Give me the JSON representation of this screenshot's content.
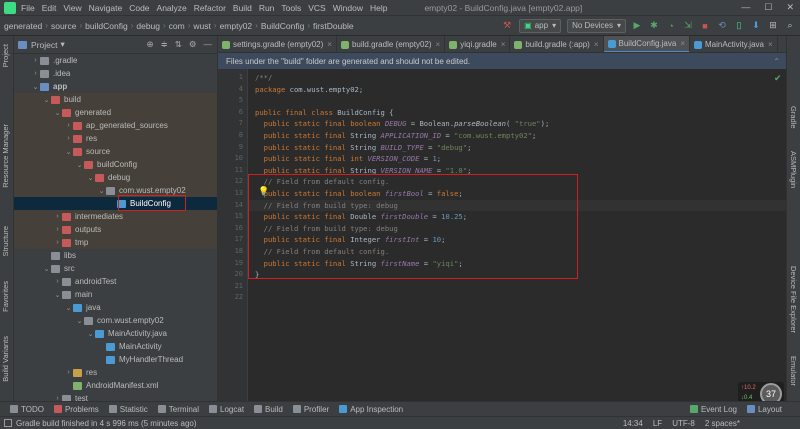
{
  "window": {
    "title": "empty02 - BuildConfig.java [empty02.app]",
    "menu": [
      "File",
      "Edit",
      "View",
      "Navigate",
      "Code",
      "Analyze",
      "Refactor",
      "Build",
      "Run",
      "Tools",
      "VCS",
      "Window",
      "Help"
    ],
    "controls": [
      "—",
      "☐",
      "✕"
    ]
  },
  "navbar": {
    "crumbs": [
      "generated",
      "source",
      "buildConfig",
      "debug",
      "com",
      "wust",
      "empty02",
      "BuildConfig",
      "firstDouble"
    ],
    "run_config": "app",
    "device": "No Devices"
  },
  "left_strip": [
    "Project",
    "Resource Manager",
    "Structure",
    "Favorites",
    "Build Variants"
  ],
  "right_strip": [
    "Gradle",
    "ASMPlugin",
    "Device File Explorer",
    "Emulator"
  ],
  "project_panel": {
    "title": "Project",
    "rows": [
      {
        "label": ".gradle",
        "indent": 1,
        "arrow": "›",
        "color": "#8a8f96"
      },
      {
        "label": ".idea",
        "indent": 1,
        "arrow": "›",
        "color": "#8a8f96"
      },
      {
        "label": "app",
        "indent": 1,
        "arrow": "⌄",
        "color": "#6a8ec0",
        "bold": true
      },
      {
        "label": "build",
        "indent": 2,
        "arrow": "⌄",
        "color": "#c65a5a"
      },
      {
        "label": "generated",
        "indent": 3,
        "arrow": "⌄",
        "color": "#c65a5a"
      },
      {
        "label": "ap_generated_sources",
        "indent": 4,
        "arrow": "›",
        "color": "#c65a5a"
      },
      {
        "label": "res",
        "indent": 4,
        "arrow": "›",
        "color": "#c65a5a"
      },
      {
        "label": "source",
        "indent": 4,
        "arrow": "⌄",
        "color": "#c65a5a"
      },
      {
        "label": "buildConfig",
        "indent": 5,
        "arrow": "⌄",
        "color": "#c65a5a"
      },
      {
        "label": "debug",
        "indent": 6,
        "arrow": "⌄",
        "color": "#c65a5a"
      },
      {
        "label": "com.wust.empty02",
        "indent": 7,
        "arrow": "⌄",
        "color": "#8a8f96"
      },
      {
        "label": "BuildConfig",
        "indent": 8,
        "arrow": "",
        "color": "#4a9bd4",
        "selected": true
      },
      {
        "label": "intermediates",
        "indent": 3,
        "arrow": "›",
        "color": "#c65a5a"
      },
      {
        "label": "outputs",
        "indent": 3,
        "arrow": "›",
        "color": "#c65a5a"
      },
      {
        "label": "tmp",
        "indent": 3,
        "arrow": "›",
        "color": "#c65a5a"
      },
      {
        "label": "libs",
        "indent": 2,
        "arrow": "",
        "color": "#8a8f96"
      },
      {
        "label": "src",
        "indent": 2,
        "arrow": "⌄",
        "color": "#8a8f96"
      },
      {
        "label": "androidTest",
        "indent": 3,
        "arrow": "›",
        "color": "#8a8f96"
      },
      {
        "label": "main",
        "indent": 3,
        "arrow": "⌄",
        "color": "#8a8f96"
      },
      {
        "label": "java",
        "indent": 4,
        "arrow": "⌄",
        "color": "#4a9bd4"
      },
      {
        "label": "com.wust.empty02",
        "indent": 5,
        "arrow": "⌄",
        "color": "#8a8f96"
      },
      {
        "label": "MainActivity.java",
        "indent": 6,
        "arrow": "⌄",
        "color": "#4a9bd4"
      },
      {
        "label": "MainActivity",
        "indent": 7,
        "arrow": "",
        "color": "#4a9bd4"
      },
      {
        "label": "MyHandlerThread",
        "indent": 7,
        "arrow": "",
        "color": "#4a9bd4"
      },
      {
        "label": "res",
        "indent": 4,
        "arrow": "›",
        "color": "#c8a04a"
      },
      {
        "label": "AndroidManifest.xml",
        "indent": 4,
        "arrow": "",
        "color": "#7fb36b"
      },
      {
        "label": "test",
        "indent": 3,
        "arrow": "›",
        "color": "#8a8f96"
      }
    ]
  },
  "tabs": [
    {
      "label": "settings.gradle (empty02)",
      "color": "#7fb36b",
      "active": false
    },
    {
      "label": "build.gradle (empty02)",
      "color": "#7fb36b",
      "active": false
    },
    {
      "label": "yiqi.gradle",
      "color": "#7fb36b",
      "active": false
    },
    {
      "label": "build.gradle (:app)",
      "color": "#7fb36b",
      "active": false
    },
    {
      "label": "BuildConfig.java",
      "color": "#4a9bd4",
      "active": true
    },
    {
      "label": "MainActivity.java",
      "color": "#4a9bd4",
      "active": false
    }
  ],
  "notice": "Files under the \"build\" folder are generated and should not be edited.",
  "code": {
    "line_numbers": [
      "1",
      "4",
      "5",
      "6",
      "7",
      "8",
      "9",
      "10",
      "11",
      "12",
      "13",
      "14",
      "15",
      "16",
      "17",
      "18",
      "19",
      "20",
      "21",
      "22"
    ],
    "lines": [
      [
        [
          "/**/",
          "cmt"
        ]
      ],
      [
        [
          "package ",
          "kw"
        ],
        [
          "com.wust.empty02;",
          ""
        ]
      ],
      [
        [
          "",
          ""
        ]
      ],
      [
        [
          "public final class ",
          "kw"
        ],
        [
          "BuildConfig {",
          ""
        ]
      ],
      [
        [
          "  public static final boolean ",
          "kw"
        ],
        [
          "DEBUG",
          "fld"
        ],
        [
          " = Boolean.",
          ""
        ],
        [
          "parseBoolean",
          "mt"
        ],
        [
          "( ",
          ""
        ],
        [
          "\"true\"",
          "str"
        ],
        [
          ");",
          ""
        ]
      ],
      [
        [
          "  public static final ",
          "kw"
        ],
        [
          "String ",
          ""
        ],
        [
          "APPLICATION_ID",
          "fld"
        ],
        [
          " = ",
          ""
        ],
        [
          "\"com.wust.empty02\"",
          "str"
        ],
        [
          ";",
          ""
        ]
      ],
      [
        [
          "  public static final ",
          "kw"
        ],
        [
          "String ",
          ""
        ],
        [
          "BUILD_TYPE",
          "fld"
        ],
        [
          " = ",
          ""
        ],
        [
          "\"debug\"",
          "str"
        ],
        [
          ";",
          ""
        ]
      ],
      [
        [
          "  public static final int ",
          "kw"
        ],
        [
          "VERSION_CODE",
          "fld"
        ],
        [
          " = ",
          ""
        ],
        [
          "1",
          "num"
        ],
        [
          ";",
          ""
        ]
      ],
      [
        [
          "  public static final ",
          "kw"
        ],
        [
          "String ",
          ""
        ],
        [
          "VERSION_NAME",
          "fld"
        ],
        [
          " = ",
          ""
        ],
        [
          "\"1.0\"",
          "str"
        ],
        [
          ";",
          ""
        ]
      ],
      [
        [
          "  // Field from default config.",
          "cmt"
        ]
      ],
      [
        [
          "  public static final boolean ",
          "kw"
        ],
        [
          "firstBool",
          "fld"
        ],
        [
          " = ",
          ""
        ],
        [
          "false",
          "kw"
        ],
        [
          ";",
          ""
        ]
      ],
      [
        [
          "  // Field from build type: debug",
          "cmt"
        ]
      ],
      [
        [
          "  public static final ",
          "kw"
        ],
        [
          "Double ",
          ""
        ],
        [
          "firstDouble",
          "fld"
        ],
        [
          " = ",
          ""
        ],
        [
          "10.25",
          "num"
        ],
        [
          ";",
          ""
        ]
      ],
      [
        [
          "  // Field from build type: debug",
          "cmt"
        ]
      ],
      [
        [
          "  public static final ",
          "kw"
        ],
        [
          "Integer ",
          ""
        ],
        [
          "firstInt",
          "fld"
        ],
        [
          " = ",
          ""
        ],
        [
          "10",
          "num"
        ],
        [
          ";",
          ""
        ]
      ],
      [
        [
          "  // Field from default config.",
          "cmt"
        ]
      ],
      [
        [
          "  public static final ",
          "kw"
        ],
        [
          "String ",
          ""
        ],
        [
          "firstName",
          "fld"
        ],
        [
          " = ",
          ""
        ],
        [
          "\"yiqi\"",
          "str"
        ],
        [
          ";",
          ""
        ]
      ],
      [
        [
          "}",
          ""
        ]
      ],
      [
        [
          "",
          ""
        ]
      ],
      [
        [
          "",
          ""
        ]
      ]
    ]
  },
  "bottom_tools": [
    {
      "label": "TODO",
      "color": "#8a8f96"
    },
    {
      "label": "Problems",
      "color": "#c65a5a"
    },
    {
      "label": "Statistic",
      "color": "#8a8f96"
    },
    {
      "label": "Terminal",
      "color": "#8a8f96"
    },
    {
      "label": "Logcat",
      "color": "#8a8f96"
    },
    {
      "label": "Build",
      "color": "#8a8f96"
    },
    {
      "label": "Profiler",
      "color": "#8a8f96"
    },
    {
      "label": "App Inspection",
      "color": "#4a9bd4"
    }
  ],
  "bottom_right": {
    "event_log": "Event Log",
    "layout": "Layout"
  },
  "status": {
    "message": "Gradle build finished in 4 s 996 ms (5 minutes ago)",
    "position": "14:34",
    "line_sep": "LF",
    "encoding": "UTF-8",
    "indent": "2 spaces*"
  },
  "memory": {
    "up": "10.2",
    "down": "0.4",
    "percent": "37"
  }
}
